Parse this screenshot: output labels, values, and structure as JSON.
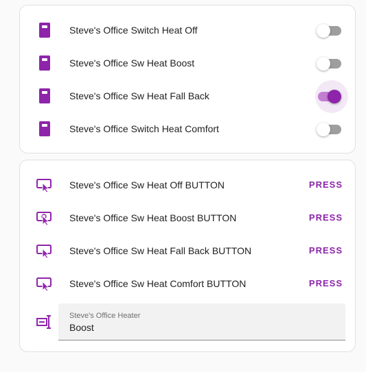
{
  "colors": {
    "accent": "#8e24aa",
    "accent_light": "#c27fd1",
    "toggle_off_track": "#9e9e9e",
    "card_border": "#e0e0e0",
    "background": "#fafafa"
  },
  "switches": [
    {
      "label": "Steve's Office Switch Heat Off",
      "icon": "power-socket-icon",
      "state": "off"
    },
    {
      "label": "Steve's Office Sw Heat Boost",
      "icon": "power-socket-icon",
      "state": "off"
    },
    {
      "label": "Steve's Office Sw Heat Fall Back",
      "icon": "power-socket-icon",
      "state": "on"
    },
    {
      "label": "Steve's Office Switch Heat Comfort",
      "icon": "power-socket-icon",
      "state": "off"
    }
  ],
  "buttons": [
    {
      "label": "Steve's Office Sw Heat Off BUTTON",
      "action": "PRESS",
      "icon": "gesture-tap-button-icon"
    },
    {
      "label": "Steve's Office Sw Heat Boost BUTTON",
      "action": "PRESS",
      "icon": "gesture-tap-button-icon"
    },
    {
      "label": "Steve's Office Sw Heat Fall Back BUTTON",
      "action": "PRESS",
      "icon": "gesture-tap-button-icon"
    },
    {
      "label": "Steve's Office Sw Heat Comfort BUTTON",
      "action": "PRESS",
      "icon": "gesture-tap-button-icon"
    }
  ],
  "heater_select": {
    "label": "Steve's Office Heater",
    "value": "Boost",
    "icon": "form-select-icon"
  }
}
